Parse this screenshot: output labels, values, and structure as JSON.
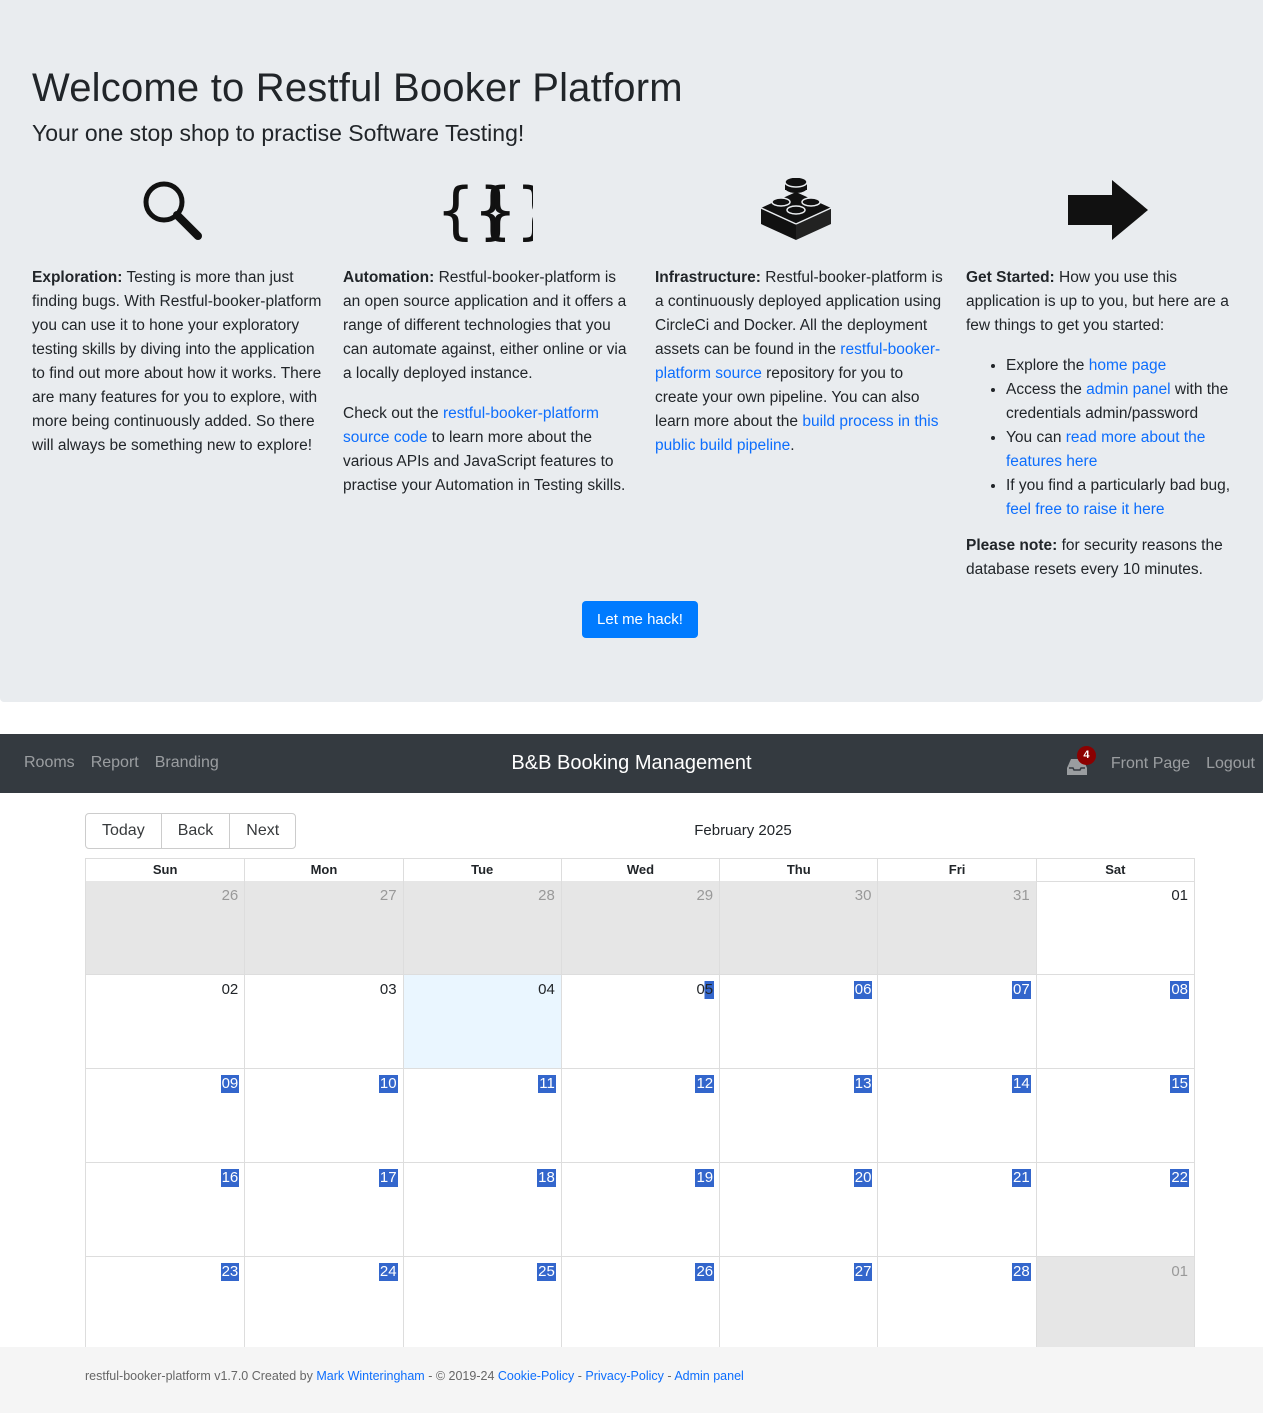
{
  "hero": {
    "title": "Welcome to Restful Booker Platform",
    "subtitle": "Your one stop shop to practise Software Testing!",
    "hack_button": "Let me hack!",
    "columns": {
      "exploration": {
        "icon": "magnifier-icon",
        "heading": "Exploration:",
        "text": " Testing is more than just finding bugs. With Restful-booker-platform you can use it to hone your exploratory testing skills by diving into the application to find out more about how it works. There are many features for you to explore, with more being continuously added. So there will always be something new to explore!"
      },
      "automation": {
        "icon": "curly-braces-icon",
        "heading": "Automation:",
        "text": " Restful-booker-platform is an open source application and it offers a range of different technologies that you can automate against, either online or via a locally deployed instance.",
        "p2_before": "Check out the ",
        "p2_link": "restful-booker-platform source code",
        "p2_after": " to learn more about the various APIs and JavaScript features to practise your Automation in Testing skills."
      },
      "infrastructure": {
        "icon": "lego-brick-icon",
        "heading": "Infrastructure:",
        "text_before": " Restful-booker-platform is a continuously deployed application using CircleCi and Docker. All the deployment assets can be found in the ",
        "link1": "restful-booker-platform source",
        "text_middle": " repository for you to create your own pipeline. You can also learn more about the ",
        "link2": "build process in this public build pipeline",
        "text_after": "."
      },
      "get_started": {
        "icon": "arrow-right-icon",
        "heading": "Get Started:",
        "text": " How you use this application is up to you, but here are a few things to get you started:",
        "items": [
          {
            "before": "Explore the ",
            "link": "home page",
            "after": ""
          },
          {
            "before": "Access the ",
            "link": "admin panel",
            "after": " with the credentials admin/password"
          },
          {
            "before": "You can ",
            "link": "read more about the features here",
            "after": ""
          },
          {
            "before": "If you find a particularly bad bug, ",
            "link": "feel free to raise it here",
            "after": ""
          }
        ],
        "note_heading": "Please note:",
        "note_text": " for security reasons the database resets every 10 minutes."
      }
    }
  },
  "navbar": {
    "links_left": [
      "Rooms",
      "Report",
      "Branding"
    ],
    "brand": "B&B Booking Management",
    "inbox_icon": "inbox-icon",
    "inbox_count": "4",
    "links_right": [
      "Front Page",
      "Logout"
    ]
  },
  "calendar": {
    "buttons": [
      "Today",
      "Back",
      "Next"
    ],
    "label": "February 2025",
    "weekdays": [
      "Sun",
      "Mon",
      "Tue",
      "Wed",
      "Thu",
      "Fri",
      "Sat"
    ],
    "weeks": [
      [
        {
          "d": "26",
          "off": true
        },
        {
          "d": "27",
          "off": true
        },
        {
          "d": "28",
          "off": true
        },
        {
          "d": "29",
          "off": true
        },
        {
          "d": "30",
          "off": true
        },
        {
          "d": "31",
          "off": true
        },
        {
          "d": "01"
        }
      ],
      [
        {
          "d": "02"
        },
        {
          "d": "03"
        },
        {
          "d": "04",
          "today": true
        },
        {
          "d": "05",
          "half": true
        },
        {
          "d": "06",
          "hl": true
        },
        {
          "d": "07",
          "hl": true
        },
        {
          "d": "08",
          "hl": true
        }
      ],
      [
        {
          "d": "09",
          "hl": true
        },
        {
          "d": "10",
          "hl": true
        },
        {
          "d": "11",
          "hl": true
        },
        {
          "d": "12",
          "hl": true
        },
        {
          "d": "13",
          "hl": true
        },
        {
          "d": "14",
          "hl": true
        },
        {
          "d": "15",
          "hl": true
        }
      ],
      [
        {
          "d": "16",
          "hl": true
        },
        {
          "d": "17",
          "hl": true
        },
        {
          "d": "18",
          "hl": true
        },
        {
          "d": "19",
          "hl": true
        },
        {
          "d": "20",
          "hl": true
        },
        {
          "d": "21",
          "hl": true
        },
        {
          "d": "22",
          "hl": true
        }
      ],
      [
        {
          "d": "23",
          "hl": true
        },
        {
          "d": "24",
          "hl": true
        },
        {
          "d": "25",
          "hl": true
        },
        {
          "d": "26",
          "hl": true
        },
        {
          "d": "27",
          "hl": true
        },
        {
          "d": "28",
          "hl": true
        },
        {
          "d": "01",
          "off": true
        }
      ]
    ]
  },
  "footer": {
    "prefix": "restful-booker-platform v1.7.0 Created by ",
    "author": "Mark Winteringham",
    "copyright": " - © 2019-24 ",
    "cookie": "Cookie-Policy",
    "sep1": " - ",
    "privacy": "Privacy-Policy",
    "sep2": " - ",
    "admin": "Admin panel"
  },
  "colors": {
    "hero_bg": "#e9ecef",
    "primary": "#007bff",
    "navbar_bg": "#343a40",
    "booked": "#3366cc",
    "today_bg": "#eaf6ff",
    "off_bg": "#e6e6e6",
    "badge": "#8b0000"
  }
}
